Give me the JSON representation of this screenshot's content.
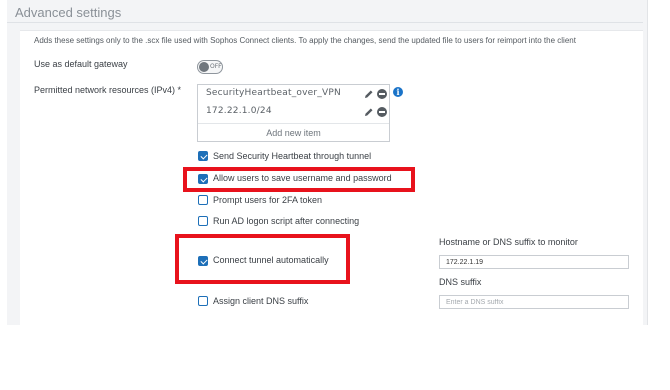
{
  "section": {
    "title": "Advanced settings",
    "hint": "Adds these settings only to the .scx file used with Sophos Connect clients. To apply the changes, send the updated file to users for reimport into the client"
  },
  "default_gateway": {
    "label": "Use as default gateway",
    "toggle_text": "OFF",
    "enabled": false
  },
  "permitted_resources": {
    "label": "Permitted network resources (IPv4) *",
    "items": [
      {
        "value": "SecurityHeartbeat_over_VPN"
      },
      {
        "value": "172.22.1.0/24"
      }
    ],
    "add_label": "Add new item"
  },
  "options": [
    {
      "label": "Send Security Heartbeat through tunnel",
      "checked": true
    },
    {
      "label": "Allow users to save username and password",
      "checked": true
    },
    {
      "label": "Prompt users for 2FA token",
      "checked": false
    },
    {
      "label": "Run AD logon script after connecting",
      "checked": false
    },
    {
      "label": "Connect tunnel automatically",
      "checked": true
    },
    {
      "label": "Assign client DNS suffix",
      "checked": false
    }
  ],
  "monitor": {
    "label": "Hostname or DNS suffix to monitor",
    "value": "172.22.1.19"
  },
  "dns_suffix": {
    "label": "DNS suffix",
    "value": "",
    "placeholder": "Enter a DNS suffix"
  },
  "colors": {
    "accent": "#1d6fb8",
    "highlight": "#e8121c",
    "info": "#1a73c8"
  }
}
